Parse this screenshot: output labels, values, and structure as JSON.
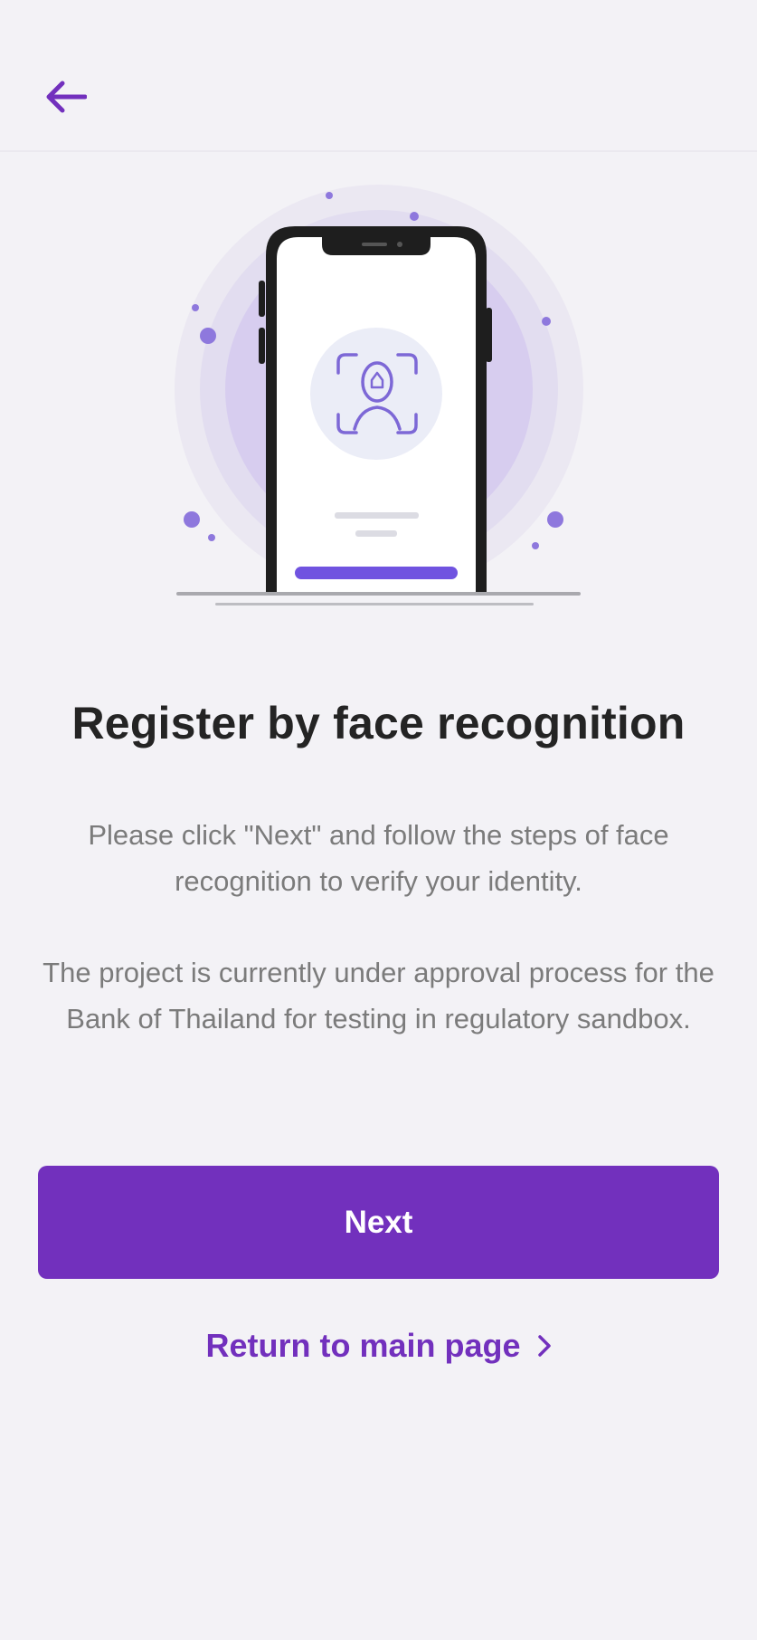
{
  "colors": {
    "accent": "#7230bd",
    "background": "#f3f2f6",
    "title": "#242424",
    "description": "#7b7b7b",
    "halo_outer": "#ebe8f2",
    "halo_inner": "#d7cdef",
    "illustration_icon": "#7d68d6"
  },
  "header": {
    "back_icon": "arrow-left-icon"
  },
  "illustration": {
    "icon": "face-scan-icon"
  },
  "content": {
    "title": "Register by face recognition",
    "description_1": "Please click \"Next\" and follow the steps of face recognition to verify your identity.",
    "description_2": "The project is currently under approval process for the Bank of Thailand for testing in regulatory sandbox."
  },
  "actions": {
    "next_label": "Next",
    "return_label": "Return to main page",
    "return_icon": "chevron-right-icon"
  }
}
